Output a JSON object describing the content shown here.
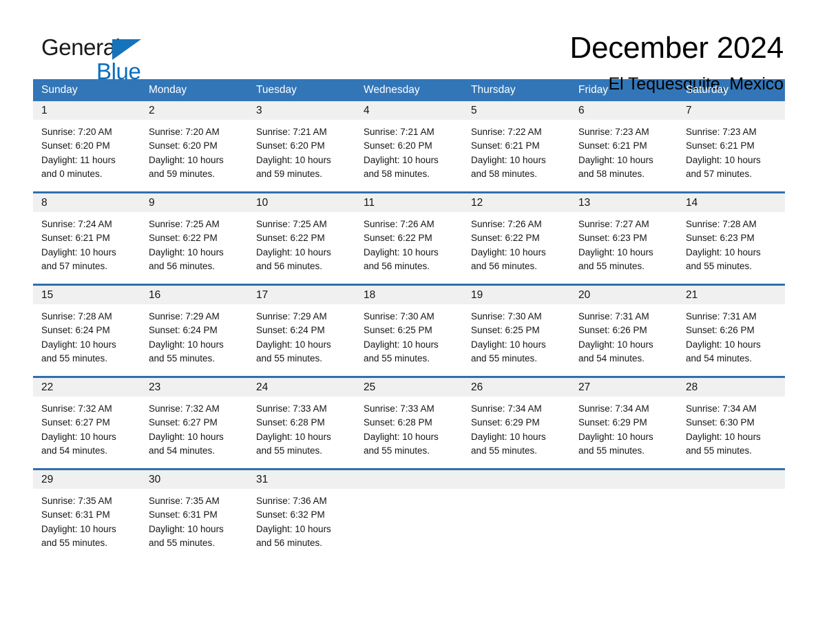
{
  "brand": {
    "name_part1": "General",
    "name_part2": "Blue",
    "triangle_color": "#1573bc",
    "blue_color": "#0a6ebd"
  },
  "header": {
    "title": "December 2024",
    "subtitle": "El Tequesquite, Mexico"
  },
  "theme": {
    "header_row_bg": "#3276b8",
    "week_divider": "#2f6fae",
    "daynum_band_bg": "#f0f0f0",
    "text_color": "#151515"
  },
  "weekdays": [
    "Sunday",
    "Monday",
    "Tuesday",
    "Wednesday",
    "Thursday",
    "Friday",
    "Saturday"
  ],
  "weeks": [
    {
      "days": [
        {
          "date": "1",
          "lines": [
            "Sunrise: 7:20 AM",
            "Sunset: 6:20 PM",
            "Daylight: 11 hours",
            "and 0 minutes."
          ]
        },
        {
          "date": "2",
          "lines": [
            "Sunrise: 7:20 AM",
            "Sunset: 6:20 PM",
            "Daylight: 10 hours",
            "and 59 minutes."
          ]
        },
        {
          "date": "3",
          "lines": [
            "Sunrise: 7:21 AM",
            "Sunset: 6:20 PM",
            "Daylight: 10 hours",
            "and 59 minutes."
          ]
        },
        {
          "date": "4",
          "lines": [
            "Sunrise: 7:21 AM",
            "Sunset: 6:20 PM",
            "Daylight: 10 hours",
            "and 58 minutes."
          ]
        },
        {
          "date": "5",
          "lines": [
            "Sunrise: 7:22 AM",
            "Sunset: 6:21 PM",
            "Daylight: 10 hours",
            "and 58 minutes."
          ]
        },
        {
          "date": "6",
          "lines": [
            "Sunrise: 7:23 AM",
            "Sunset: 6:21 PM",
            "Daylight: 10 hours",
            "and 58 minutes."
          ]
        },
        {
          "date": "7",
          "lines": [
            "Sunrise: 7:23 AM",
            "Sunset: 6:21 PM",
            "Daylight: 10 hours",
            "and 57 minutes."
          ]
        }
      ]
    },
    {
      "days": [
        {
          "date": "8",
          "lines": [
            "Sunrise: 7:24 AM",
            "Sunset: 6:21 PM",
            "Daylight: 10 hours",
            "and 57 minutes."
          ]
        },
        {
          "date": "9",
          "lines": [
            "Sunrise: 7:25 AM",
            "Sunset: 6:22 PM",
            "Daylight: 10 hours",
            "and 56 minutes."
          ]
        },
        {
          "date": "10",
          "lines": [
            "Sunrise: 7:25 AM",
            "Sunset: 6:22 PM",
            "Daylight: 10 hours",
            "and 56 minutes."
          ]
        },
        {
          "date": "11",
          "lines": [
            "Sunrise: 7:26 AM",
            "Sunset: 6:22 PM",
            "Daylight: 10 hours",
            "and 56 minutes."
          ]
        },
        {
          "date": "12",
          "lines": [
            "Sunrise: 7:26 AM",
            "Sunset: 6:22 PM",
            "Daylight: 10 hours",
            "and 56 minutes."
          ]
        },
        {
          "date": "13",
          "lines": [
            "Sunrise: 7:27 AM",
            "Sunset: 6:23 PM",
            "Daylight: 10 hours",
            "and 55 minutes."
          ]
        },
        {
          "date": "14",
          "lines": [
            "Sunrise: 7:28 AM",
            "Sunset: 6:23 PM",
            "Daylight: 10 hours",
            "and 55 minutes."
          ]
        }
      ]
    },
    {
      "days": [
        {
          "date": "15",
          "lines": [
            "Sunrise: 7:28 AM",
            "Sunset: 6:24 PM",
            "Daylight: 10 hours",
            "and 55 minutes."
          ]
        },
        {
          "date": "16",
          "lines": [
            "Sunrise: 7:29 AM",
            "Sunset: 6:24 PM",
            "Daylight: 10 hours",
            "and 55 minutes."
          ]
        },
        {
          "date": "17",
          "lines": [
            "Sunrise: 7:29 AM",
            "Sunset: 6:24 PM",
            "Daylight: 10 hours",
            "and 55 minutes."
          ]
        },
        {
          "date": "18",
          "lines": [
            "Sunrise: 7:30 AM",
            "Sunset: 6:25 PM",
            "Daylight: 10 hours",
            "and 55 minutes."
          ]
        },
        {
          "date": "19",
          "lines": [
            "Sunrise: 7:30 AM",
            "Sunset: 6:25 PM",
            "Daylight: 10 hours",
            "and 55 minutes."
          ]
        },
        {
          "date": "20",
          "lines": [
            "Sunrise: 7:31 AM",
            "Sunset: 6:26 PM",
            "Daylight: 10 hours",
            "and 54 minutes."
          ]
        },
        {
          "date": "21",
          "lines": [
            "Sunrise: 7:31 AM",
            "Sunset: 6:26 PM",
            "Daylight: 10 hours",
            "and 54 minutes."
          ]
        }
      ]
    },
    {
      "days": [
        {
          "date": "22",
          "lines": [
            "Sunrise: 7:32 AM",
            "Sunset: 6:27 PM",
            "Daylight: 10 hours",
            "and 54 minutes."
          ]
        },
        {
          "date": "23",
          "lines": [
            "Sunrise: 7:32 AM",
            "Sunset: 6:27 PM",
            "Daylight: 10 hours",
            "and 54 minutes."
          ]
        },
        {
          "date": "24",
          "lines": [
            "Sunrise: 7:33 AM",
            "Sunset: 6:28 PM",
            "Daylight: 10 hours",
            "and 55 minutes."
          ]
        },
        {
          "date": "25",
          "lines": [
            "Sunrise: 7:33 AM",
            "Sunset: 6:28 PM",
            "Daylight: 10 hours",
            "and 55 minutes."
          ]
        },
        {
          "date": "26",
          "lines": [
            "Sunrise: 7:34 AM",
            "Sunset: 6:29 PM",
            "Daylight: 10 hours",
            "and 55 minutes."
          ]
        },
        {
          "date": "27",
          "lines": [
            "Sunrise: 7:34 AM",
            "Sunset: 6:29 PM",
            "Daylight: 10 hours",
            "and 55 minutes."
          ]
        },
        {
          "date": "28",
          "lines": [
            "Sunrise: 7:34 AM",
            "Sunset: 6:30 PM",
            "Daylight: 10 hours",
            "and 55 minutes."
          ]
        }
      ]
    },
    {
      "days": [
        {
          "date": "29",
          "lines": [
            "Sunrise: 7:35 AM",
            "Sunset: 6:31 PM",
            "Daylight: 10 hours",
            "and 55 minutes."
          ]
        },
        {
          "date": "30",
          "lines": [
            "Sunrise: 7:35 AM",
            "Sunset: 6:31 PM",
            "Daylight: 10 hours",
            "and 55 minutes."
          ]
        },
        {
          "date": "31",
          "lines": [
            "Sunrise: 7:36 AM",
            "Sunset: 6:32 PM",
            "Daylight: 10 hours",
            "and 56 minutes."
          ]
        },
        {
          "date": "",
          "lines": []
        },
        {
          "date": "",
          "lines": []
        },
        {
          "date": "",
          "lines": []
        },
        {
          "date": "",
          "lines": []
        }
      ]
    }
  ]
}
